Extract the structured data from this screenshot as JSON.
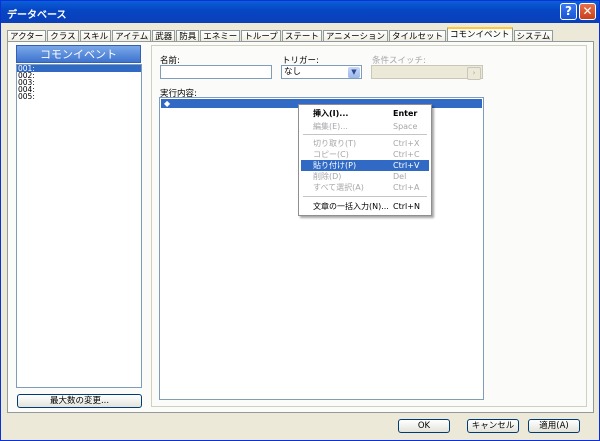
{
  "window": {
    "title": "データベース",
    "help_glyph": "?",
    "close_glyph": "✕"
  },
  "tabs": [
    {
      "label": "アクター"
    },
    {
      "label": "クラス"
    },
    {
      "label": "スキル"
    },
    {
      "label": "アイテム"
    },
    {
      "label": "武器"
    },
    {
      "label": "防具"
    },
    {
      "label": "エネミー"
    },
    {
      "label": "トループ"
    },
    {
      "label": "ステート"
    },
    {
      "label": "アニメーション"
    },
    {
      "label": "タイルセット"
    },
    {
      "label": "コモンイベント",
      "active": true
    },
    {
      "label": "システム"
    }
  ],
  "left": {
    "header": "コモンイベント",
    "items": [
      {
        "label": "001:",
        "selected": true
      },
      {
        "label": "002:"
      },
      {
        "label": "003:"
      },
      {
        "label": "004:"
      },
      {
        "label": "005:"
      }
    ],
    "max_button": "最大数の変更..."
  },
  "form": {
    "name_label": "名前:",
    "name_value": "",
    "trigger_label": "トリガー:",
    "trigger_value": "なし",
    "switch_label": "条件スイッチ:",
    "contents_label": "実行内容:",
    "first_row": "◆"
  },
  "context_menu": {
    "items": [
      {
        "label": "挿入(I)...",
        "shortcut": "Enter",
        "state": "bold"
      },
      {
        "label": "編集(E)...",
        "shortcut": "Space",
        "state": "disabled"
      },
      {
        "label": "切り取り(T)",
        "shortcut": "Ctrl+X",
        "state": "disabled"
      },
      {
        "label": "コピー(C)",
        "shortcut": "Ctrl+C",
        "state": "disabled"
      },
      {
        "label": "貼り付け(P)",
        "shortcut": "Ctrl+V",
        "state": "highlight"
      },
      {
        "label": "削除(D)",
        "shortcut": "Del",
        "state": "disabled"
      },
      {
        "label": "すべて選択(A)",
        "shortcut": "Ctrl+A",
        "state": "disabled"
      },
      {
        "label": "文章の一括入力(N)...",
        "shortcut": "Ctrl+N",
        "state": "normal"
      }
    ]
  },
  "footer": {
    "ok": "OK",
    "cancel": "キャンセル",
    "apply": "適用(A)"
  }
}
